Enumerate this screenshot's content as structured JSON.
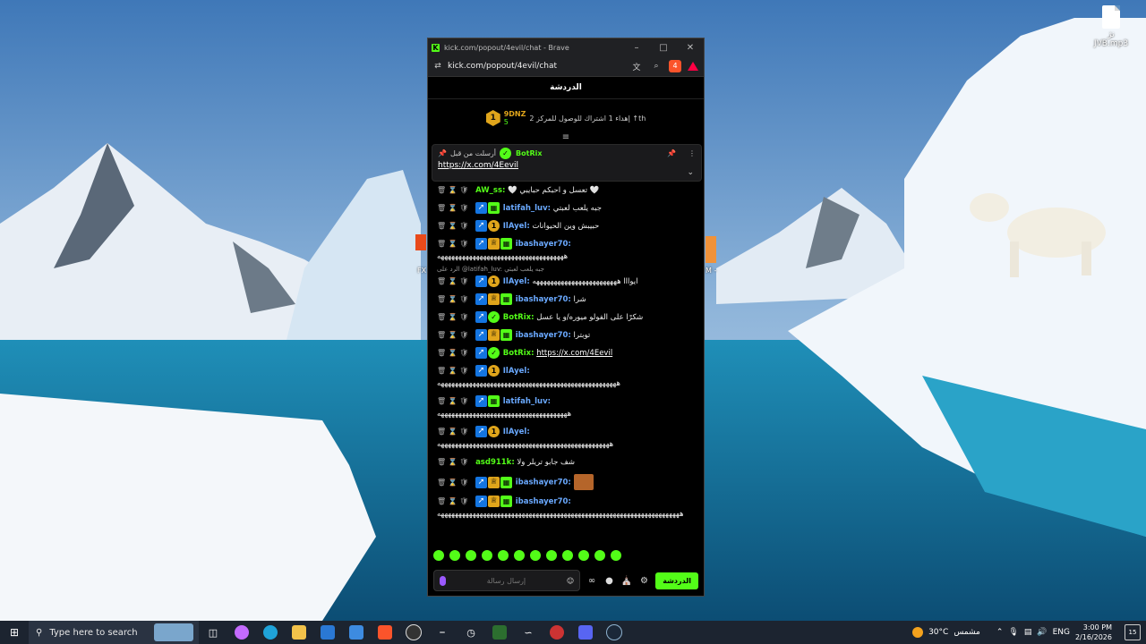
{
  "desktop": {
    "file_label": "نژ‎ JVB.mp3",
    "peek_left": "FX",
    "peek_right": "M -"
  },
  "browser": {
    "title": "kick.com/popout/4evil/chat - Brave",
    "url": "kick.com/popout/4evil/chat",
    "shields_count": "4"
  },
  "chat": {
    "header": "الدردشة",
    "goal": {
      "badge": "1",
      "username": "9DNZ",
      "count": "5",
      "text": "إهداء 1 اشتراك للوصول للمركز 2 ↑th"
    },
    "pinned": {
      "label": "أرسلت من قبل",
      "username": "BotRix",
      "link": "https://x.com/4Eevil"
    },
    "reply_note": "الرد على @latifah_luv: جبه يلعب لعبتي",
    "messages": [
      {
        "user": "AW_ss:",
        "color": "#53fc18",
        "text": "🤍 تعسل و احبكم حبايبي 🤍"
      },
      {
        "user": "latifah_luv:",
        "color": "#6aa9ff",
        "text": "جبه يلعب لعبتي"
      },
      {
        "user": "IlAyel:",
        "color": "#6aa9ff",
        "text": "حبيبش وين الحيوانات"
      },
      {
        "user": "ibashayer70:",
        "color": "#6aa9ff",
        "text": "ههههههههههههههههههههههههههههههههههههه"
      },
      {
        "user": "IlAyel:",
        "color": "#6aa9ff",
        "text": "ايوااا ههههههههههههههههههههههههه"
      },
      {
        "user": "ibashayer70:",
        "color": "#6aa9ff",
        "text": "شرا"
      },
      {
        "user": "BotRix:",
        "color": "#53fc18",
        "text": "شكرًا على الفولو ميوره/و يا عسل"
      },
      {
        "user": "ibashayer70:",
        "color": "#6aa9ff",
        "text": "توبترا"
      },
      {
        "user": "BotRix:",
        "color": "#53fc18",
        "text": "https://x.com/4Eevil"
      },
      {
        "user": "IlAyel:",
        "color": "#6aa9ff",
        "text": "هههههههههههههههههههههههههههههههههههههههههههههههههههه"
      },
      {
        "user": "latifah_luv:",
        "color": "#6aa9ff",
        "text": "هههههههههههههههههههههههههههههههههههههه"
      },
      {
        "user": "IlAyel:",
        "color": "#6aa9ff",
        "text": "هههههههههههههههههههههههههههههههههههههههههههههههههه"
      },
      {
        "user": "asd911k:",
        "color": "#53fc18",
        "text": "شف جابو تريلر ولا"
      },
      {
        "user": "ibashayer70:",
        "color": "#6aa9ff",
        "text": ""
      },
      {
        "user": "ibashayer70:",
        "color": "#6aa9ff",
        "text": "هههههههههههههههههههههههههههههههههههههههههههههههههههههههههههههههههههههه"
      }
    ],
    "input_placeholder": "إرسال رسالة",
    "send_label": "الدردشة"
  },
  "taskbar": {
    "search_placeholder": "Type here to search",
    "weather_temp": "30°C",
    "weather_label": "مشمس",
    "language": "ENG",
    "time": "3:00 PM",
    "date": "2/16/2026",
    "notifications": "15"
  }
}
